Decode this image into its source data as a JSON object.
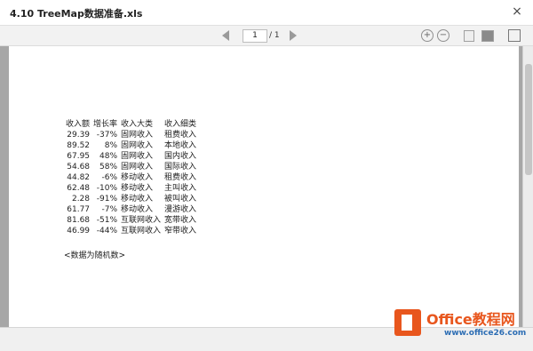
{
  "window": {
    "title": "4.10 TreeMap数据准备.xls",
    "close_symbol": "×"
  },
  "toolbar": {
    "page_current": "1",
    "page_total": "/ 1",
    "zoom_in_symbol": "+",
    "zoom_out_symbol": "−"
  },
  "table": {
    "headers": [
      "收入额",
      "增长率",
      "收入大类",
      "收入细类"
    ],
    "rows": [
      [
        "29.39",
        "-37%",
        "固网收入",
        "租费收入"
      ],
      [
        "89.52",
        "8%",
        "固网收入",
        "本地收入"
      ],
      [
        "67.95",
        "48%",
        "固网收入",
        "国内收入"
      ],
      [
        "54.68",
        "58%",
        "固网收入",
        "国际收入"
      ],
      [
        "44.82",
        "-6%",
        "移动收入",
        "租费收入"
      ],
      [
        "62.48",
        "-10%",
        "移动收入",
        "主叫收入"
      ],
      [
        "2.28",
        "-91%",
        "移动收入",
        "被叫收入"
      ],
      [
        "61.77",
        "-7%",
        "移动收入",
        "漫游收入"
      ],
      [
        "81.68",
        "-51%",
        "互联网收入",
        "宽带收入"
      ],
      [
        "46.99",
        "-44%",
        "互联网收入",
        "窄带收入"
      ]
    ]
  },
  "note": "<数据为随机数>",
  "watermark": {
    "brand": "Office教程网",
    "url": "www.office26.com"
  },
  "colors": {
    "accent": "#e8561d",
    "viewer_bg": "#a7a7a7"
  }
}
